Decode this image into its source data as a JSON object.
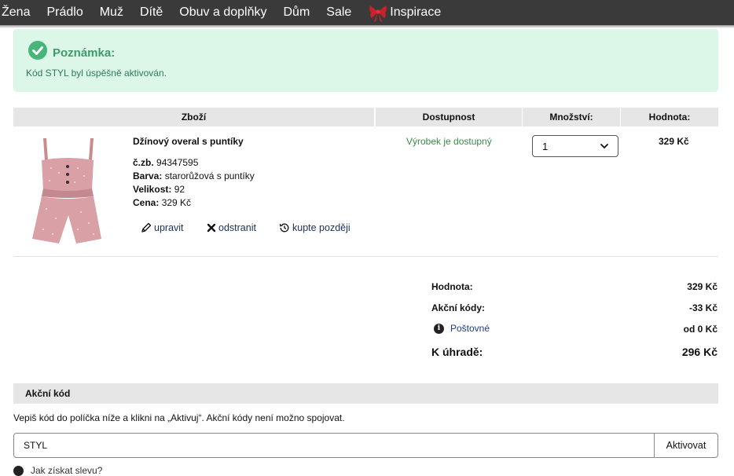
{
  "nav": {
    "items": [
      "Žena",
      "Prádlo",
      "Muž",
      "Dítě",
      "Obuv a doplňky",
      "Dům",
      "Sale",
      "Inspirace"
    ]
  },
  "note": {
    "title": "Poznámka:",
    "text": "Kód STYL byl úspěšně aktivován."
  },
  "table": {
    "headers": [
      "Zboží",
      "Dostupnost",
      "Množství:",
      "Hodnota:"
    ]
  },
  "item": {
    "name": "Džínový overal s puntíky",
    "article_label": "č.zb.",
    "article_value": "94347595",
    "color_label": "Barva:",
    "color_value": "starorůžová s puntíky",
    "size_label": "Velikost:",
    "size_value": "92",
    "price_label": "Cena:",
    "price_value": "329 Kč",
    "availability": "Výrobek je dostupný",
    "quantity": "1",
    "total": "329 Kč",
    "actions": {
      "edit": "upravit",
      "remove": "odstranit",
      "later": "kupte později"
    }
  },
  "summary": {
    "value_label": "Hodnota:",
    "value": "329 Kč",
    "promo_label": "Akční kódy:",
    "promo_value": "-33 Kč",
    "shipping_label": "Poštovné",
    "shipping_value": "od 0 Kč",
    "total_label": "K úhradě:",
    "total_value": "296 Kč"
  },
  "promo": {
    "heading": "Akční kód",
    "help": "Vepiš kód do políčka níže a klikni na „Aktivuj“. Akční kódy není možno spojovat.",
    "input_value": "STYL",
    "button": "Aktivovat",
    "howto": "Jak získat slevu?"
  },
  "colors": {
    "nav_bg": "#3a3a3a",
    "note_bg": "#dcf7e8",
    "success": "#47b47a",
    "availability": "#3a8a4a",
    "link": "#1a2f5a"
  }
}
